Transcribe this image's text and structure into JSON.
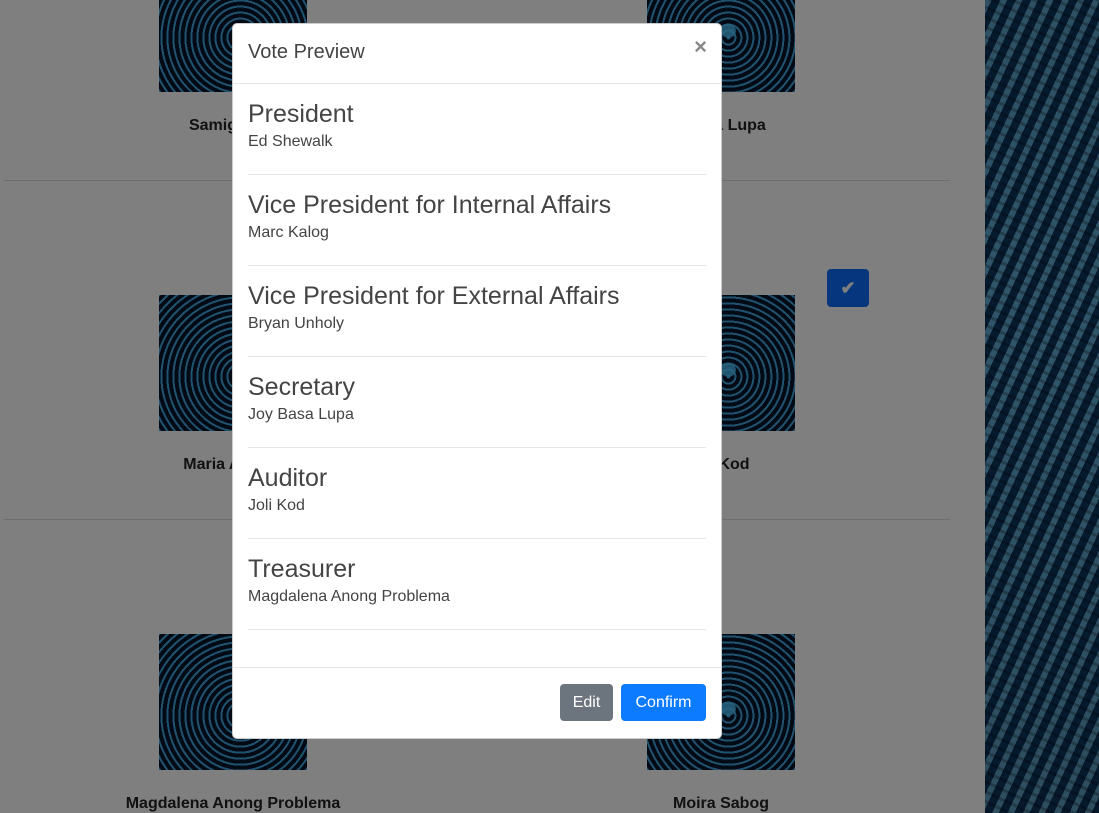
{
  "background": {
    "candidates": [
      {
        "name": "Samig",
        "col": "left",
        "row": 0
      },
      {
        "name": "a Lupa",
        "col": "right",
        "row": 0
      },
      {
        "name": "Maria Ar",
        "col": "left",
        "row": 1
      },
      {
        "name": "Kod",
        "col": "right",
        "row": 1
      },
      {
        "name": "Magdalena Anong Problema",
        "col": "left",
        "row": 2
      },
      {
        "name": "Moira Sabog",
        "col": "right",
        "row": 2
      }
    ],
    "check_icon": "check-icon",
    "accent_color": "#0d6efd"
  },
  "modal": {
    "title": "Vote Preview",
    "close_label": "×",
    "items": [
      {
        "position": "President",
        "candidate": "Ed Shewalk"
      },
      {
        "position": "Vice President for Internal Affairs",
        "candidate": "Marc Kalog"
      },
      {
        "position": "Vice President for External Affairs",
        "candidate": "Bryan Unholy"
      },
      {
        "position": "Secretary",
        "candidate": "Joy Basa Lupa"
      },
      {
        "position": "Auditor",
        "candidate": "Joli Kod"
      },
      {
        "position": "Treasurer",
        "candidate": "Magdalena Anong Problema"
      }
    ],
    "edit_label": "Edit",
    "confirm_label": "Confirm",
    "edit_color": "#6c757d",
    "confirm_color": "#0d7bff"
  }
}
